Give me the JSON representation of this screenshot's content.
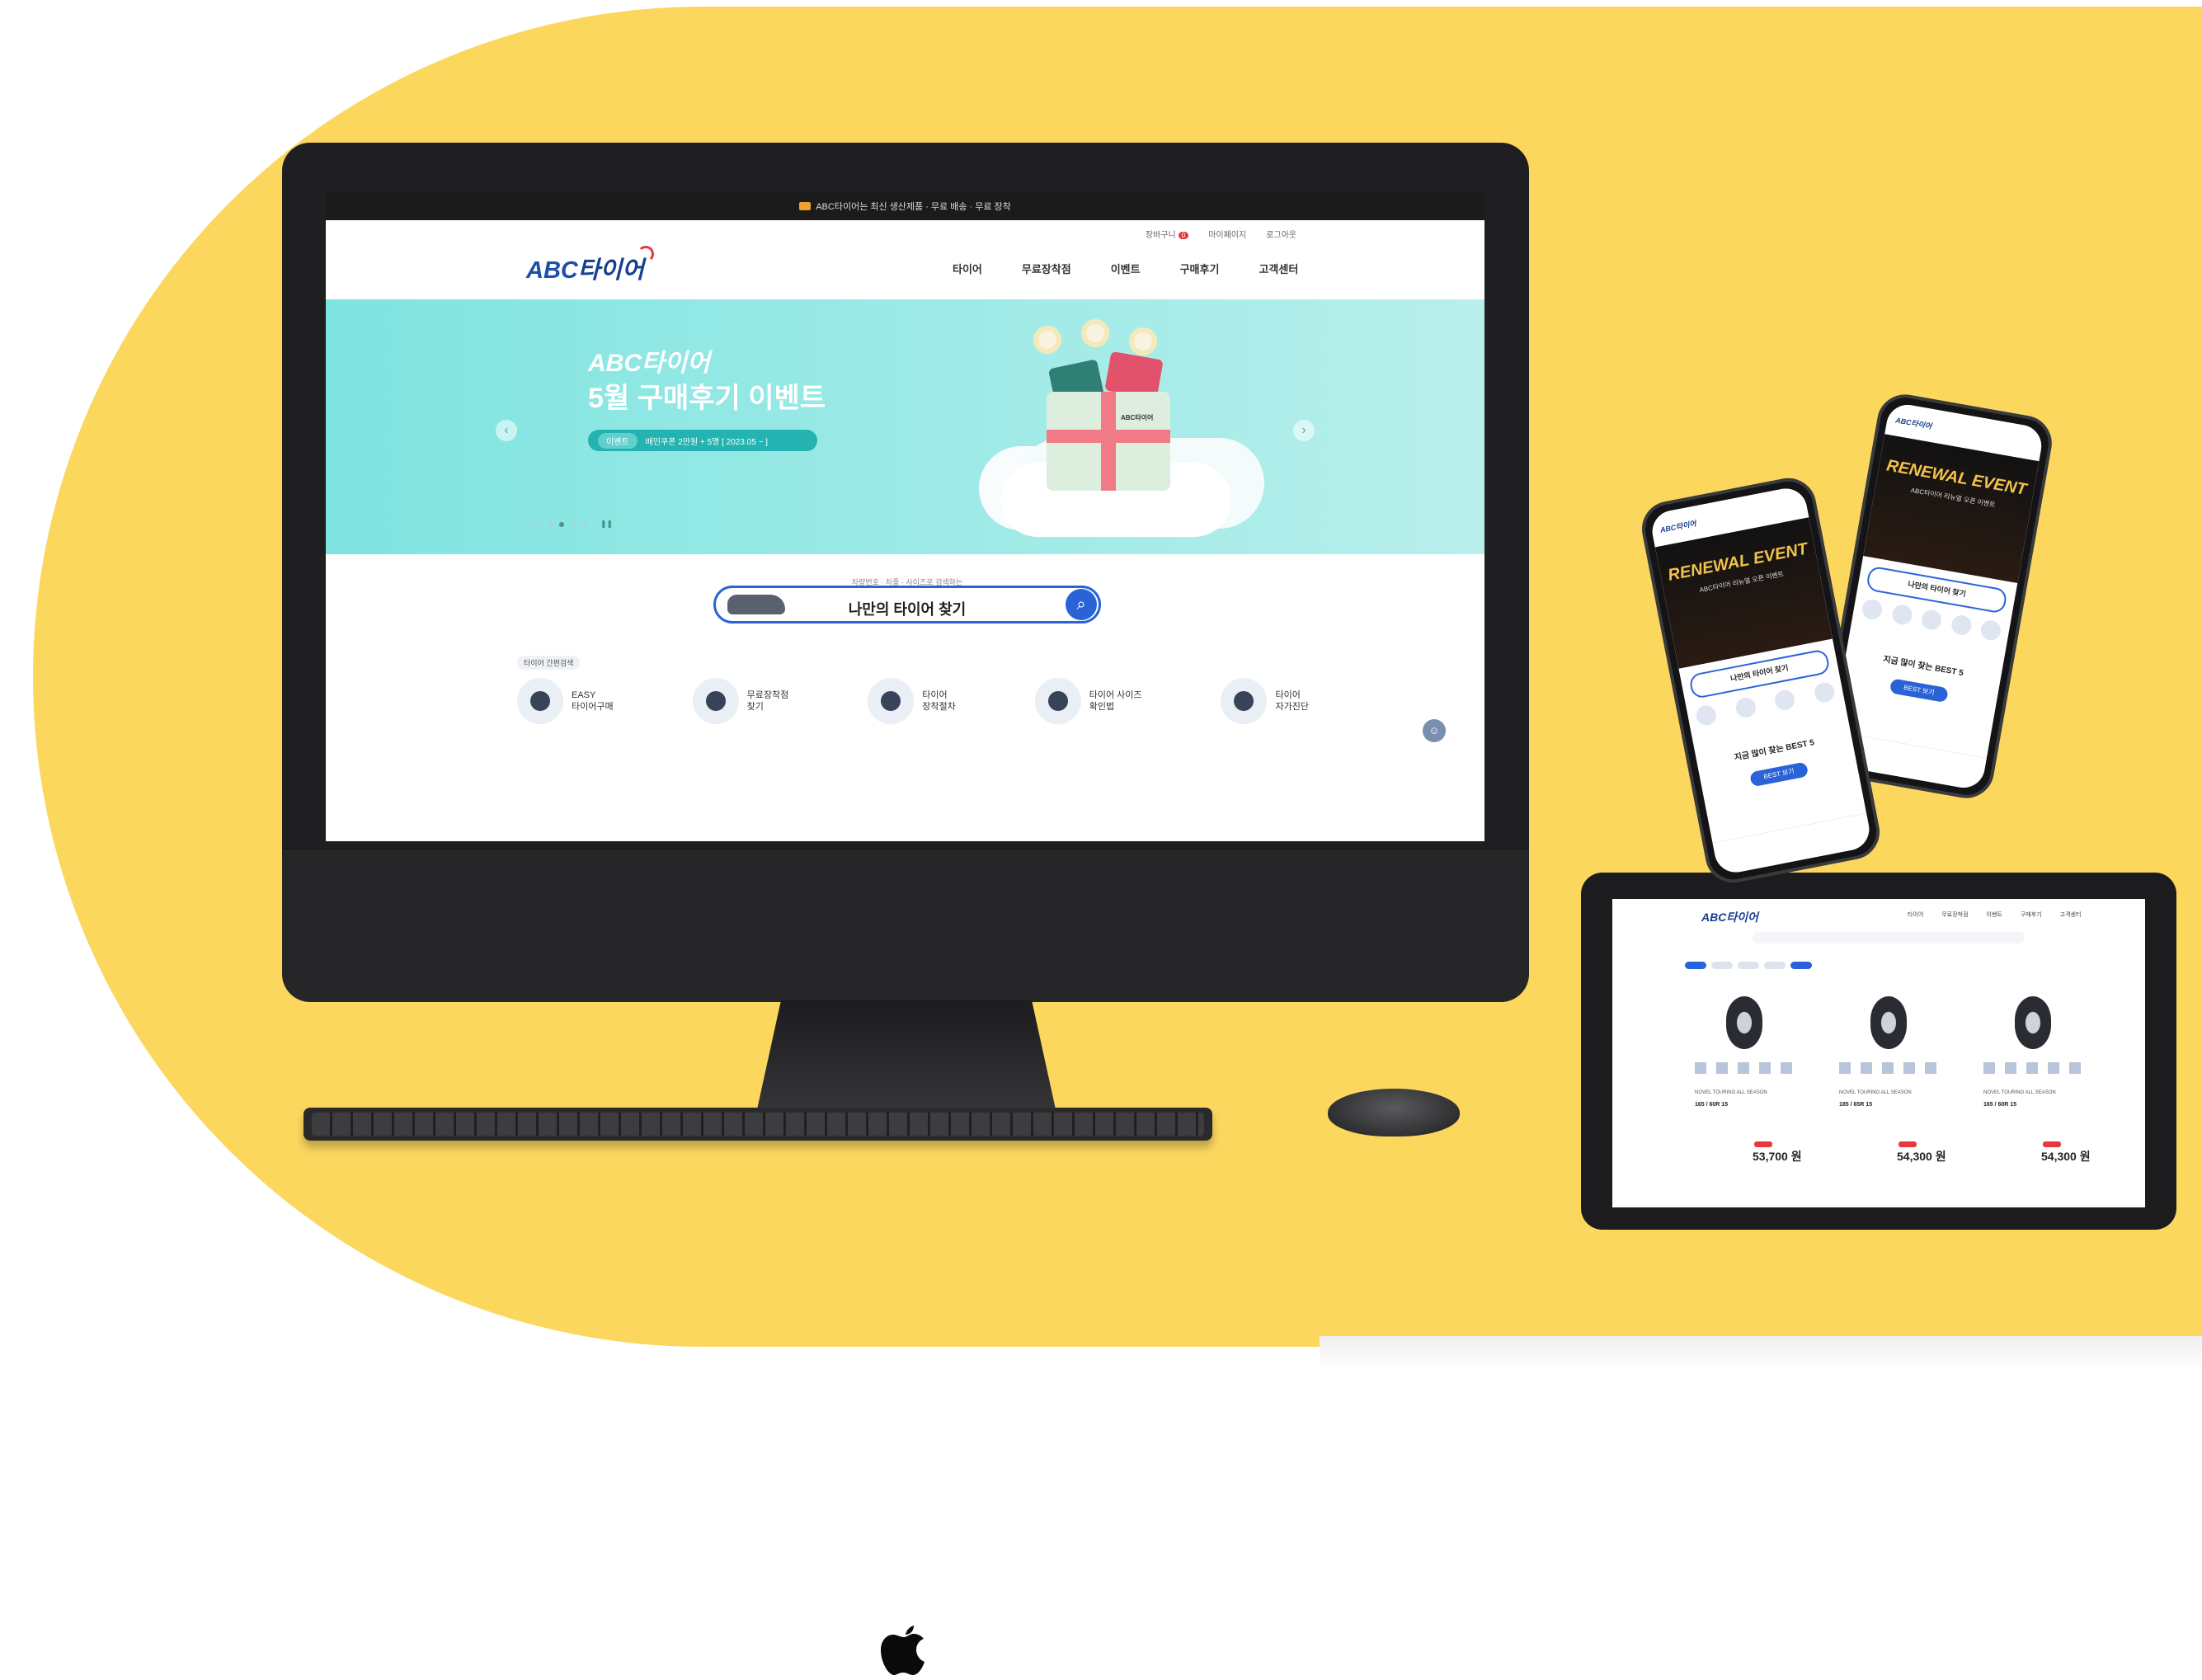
{
  "desktop": {
    "promo_bar": "ABC타이어는 최신 생산제품 · 무료 배송 · 무료 장착",
    "util_links": [
      "장바구니",
      "마이페이지",
      "로그아웃"
    ],
    "cart_count": "0",
    "logo_abc": "ABC",
    "logo_tire": "타이어",
    "nav": [
      "타이어",
      "무료장착점",
      "이벤트",
      "구매후기",
      "고객센터"
    ],
    "hero": {
      "brand": "ABC타이어",
      "title": "5월 구매후기 이벤트",
      "pill_tag": "이벤트",
      "pill_text": "배민쿠폰 2만원 + 5명 [ 2023.05 ~ ]",
      "prev": "‹",
      "next": "›",
      "pause": "❚❚",
      "gift_label": "ABC타이어"
    },
    "finder": {
      "caption": "차량번호 · 차종 · 사이즈로 검색하는",
      "label": "나만의 타이어 찾기"
    },
    "quick_label": "타이어 간편검색",
    "quick_menu": [
      {
        "label": "EASY\n타이어구매"
      },
      {
        "label": "무료장착점\n찾기"
      },
      {
        "label": "타이어\n장착절차"
      },
      {
        "label": "타이어 사이즈\n확인법"
      },
      {
        "label": "타이어\n자가진단"
      }
    ],
    "chat_icon": "☺"
  },
  "phone_front": {
    "logo": "ABC타이어",
    "banner_title": "RENEWAL EVENT",
    "banner_sub": "ABC타이어 리뉴얼 오픈 이벤트",
    "search": "나만의 타이어 찾기",
    "best": "지금 많이 찾는 BEST 5",
    "best_btn": "BEST 보기"
  },
  "phone_back": {
    "logo": "ABC타이어",
    "banner_title": "RENEWAL EVENT",
    "banner_sub": "ABC타이어 리뉴얼 오픈 이벤트",
    "search": "나만의 타이어 찾기",
    "best": "지금 많이 찾는 BEST 5",
    "best_btn": "BEST 보기"
  },
  "tablet": {
    "logo": "ABC타이어",
    "nav": [
      "타이어",
      "무료장착점",
      "이벤트",
      "구매후기",
      "고객센터"
    ],
    "products": [
      {
        "name": "NOVEL TOURING ALL SEASON",
        "size": "165 / 60R 15",
        "price": "53,700 원"
      },
      {
        "name": "NOVEL TOURING ALL SEASON",
        "size": "185 / 65R 15",
        "price": "54,300 원"
      },
      {
        "name": "NOVEL TOURING ALL SEASON",
        "size": "165 / 60R 15",
        "price": "54,300 원"
      }
    ]
  },
  "colors": {
    "background": "#fbd75e",
    "hero": "#7fe4e0",
    "brand_blue": "#1d4ea8",
    "accent_red": "#e8383d",
    "search_blue": "#2a63d8"
  }
}
